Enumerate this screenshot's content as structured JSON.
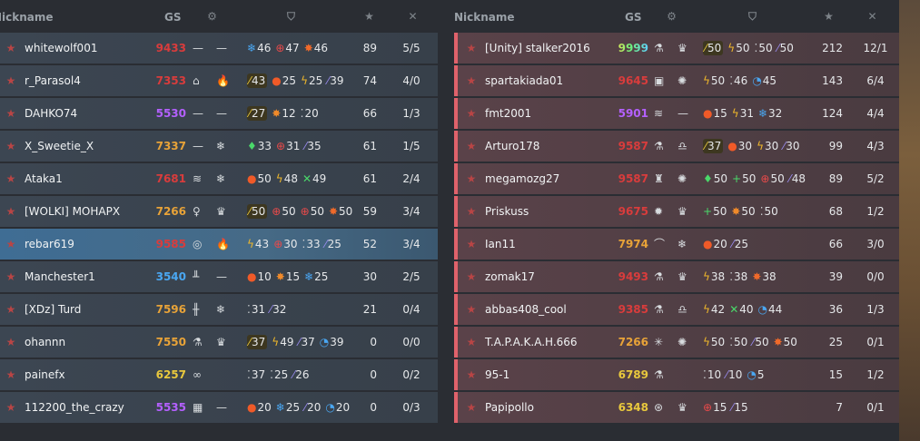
{
  "headers": {
    "nickname": "Nickname",
    "gs": "GS"
  },
  "header_icons": [
    "gear-icon",
    "shield-icon",
    "star-icon",
    "crossed-swords-icon"
  ],
  "colors": {
    "red": "#d93c3c",
    "orange": "#e8a338",
    "purple": "#b460ff",
    "blue": "#4aa7f2",
    "yellow": "#e8c83d",
    "team_accent": "#e0626b"
  },
  "teams": [
    {
      "players": [
        {
          "nick": "whitewolf001",
          "gs": "9433",
          "gs_color": "#d93c3c",
          "rank_icon": "star-rank-icon",
          "eq1": "—",
          "eq2": "—",
          "stats": [
            {
              "icon": "snowflake-icon",
              "g": "❄",
              "c": "#4aa7f2",
              "v": "46"
            },
            {
              "icon": "crosshair-icon",
              "g": "⊕",
              "c": "#e94a4a",
              "v": "47"
            },
            {
              "icon": "burst-icon",
              "g": "✸",
              "c": "#f06a2a",
              "v": "46"
            }
          ],
          "score": "89",
          "kd": "5/5"
        },
        {
          "nick": "r_Parasol4",
          "gs": "7353",
          "gs_color": "#d93c3c",
          "rank_icon": "star-rank-icon",
          "eq1": "⌂",
          "eq2": "🔥",
          "stats": [
            {
              "icon": "bullet-icon",
              "g": "⁄",
              "c": "#e8c83d",
              "v": "43",
              "hl": true
            },
            {
              "icon": "flame-icon",
              "g": "●",
              "c": "#f05a28",
              "v": "25"
            },
            {
              "icon": "lightning-icon",
              "g": "ϟ",
              "c": "#f0b82a",
              "v": "25"
            },
            {
              "icon": "syringe-icon",
              "g": "⁄",
              "c": "#9a8cf0",
              "v": "39"
            }
          ],
          "score": "74",
          "kd": "4/0"
        },
        {
          "nick": "DAHKO74",
          "gs": "5530",
          "gs_color": "#b460ff",
          "rank_icon": "chevron-rank-icon",
          "eq1": "—",
          "eq2": "—",
          "stats": [
            {
              "icon": "bullet-icon",
              "g": "⁄",
              "c": "#e8c83d",
              "v": "27",
              "hl": true
            },
            {
              "icon": "sun-icon",
              "g": "✸",
              "c": "#f08a2a",
              "v": "12"
            },
            {
              "icon": "dots-icon",
              "g": "⁚",
              "c": "#c9cdd0",
              "v": "20"
            }
          ],
          "score": "66",
          "kd": "1/3"
        },
        {
          "nick": "X_Sweetie_X",
          "gs": "7337",
          "gs_color": "#e8a338",
          "rank_icon": "triangle-rank-icon",
          "eq1": "—",
          "eq2": "❄",
          "stats": [
            {
              "icon": "gem-icon",
              "g": "♦",
              "c": "#4ad86a",
              "v": "33"
            },
            {
              "icon": "crosshair-icon",
              "g": "⊕",
              "c": "#e94a4a",
              "v": "31"
            },
            {
              "icon": "syringe-icon",
              "g": "⁄",
              "c": "#9a8cf0",
              "v": "35"
            }
          ],
          "score": "61",
          "kd": "1/5"
        },
        {
          "nick": "Ataka1",
          "gs": "7681",
          "gs_color": "#d93c3c",
          "rank_icon": "star-rank-icon",
          "eq1": "≋",
          "eq2": "❄",
          "stats": [
            {
              "icon": "flame-icon",
              "g": "●",
              "c": "#f05a28",
              "v": "50"
            },
            {
              "icon": "lightning-icon",
              "g": "ϟ",
              "c": "#f0b82a",
              "v": "48"
            },
            {
              "icon": "swords-icon",
              "g": "✕",
              "c": "#4ad86a",
              "v": "49"
            }
          ],
          "score": "61",
          "kd": "2/4"
        },
        {
          "nick": "[WOLKI] MOHAPX",
          "gs": "7266",
          "gs_color": "#e8a338",
          "rank_icon": "star-rank-icon",
          "eq1": "♀",
          "eq2": "♛",
          "stats": [
            {
              "icon": "bullet-icon",
              "g": "⁄",
              "c": "#e8c83d",
              "v": "50",
              "hl": true
            },
            {
              "icon": "crosshair-icon",
              "g": "⊕",
              "c": "#e94a4a",
              "v": "50"
            },
            {
              "icon": "crosshair-icon",
              "g": "⊕",
              "c": "#e94a4a",
              "v": "50"
            },
            {
              "icon": "burst-icon",
              "g": "✸",
              "c": "#f06a2a",
              "v": "50"
            }
          ],
          "score": "59",
          "kd": "3/4"
        },
        {
          "nick": "rebar619",
          "gs": "9585",
          "gs_color": "#d93c3c",
          "rank_icon": "star-rank-icon",
          "me": true,
          "eq1": "◎",
          "eq2": "🔥",
          "stats": [
            {
              "icon": "lightning-icon",
              "g": "ϟ",
              "c": "#f0b82a",
              "v": "43"
            },
            {
              "icon": "crosshair-icon",
              "g": "⊕",
              "c": "#e94a4a",
              "v": "30"
            },
            {
              "icon": "dots-icon",
              "g": "⁚",
              "c": "#c9cdd0",
              "v": "33"
            },
            {
              "icon": "syringe-icon",
              "g": "⁄",
              "c": "#9a8cf0",
              "v": "25"
            }
          ],
          "score": "52",
          "kd": "3/4"
        },
        {
          "nick": "Manchester1",
          "gs": "3540",
          "gs_color": "#4aa7f2",
          "rank_icon": "squares-rank-icon",
          "eq1": "╨",
          "eq2": "—",
          "stats": [
            {
              "icon": "flame-icon",
              "g": "●",
              "c": "#f05a28",
              "v": "10"
            },
            {
              "icon": "sun-icon",
              "g": "✸",
              "c": "#f08a2a",
              "v": "15"
            },
            {
              "icon": "snowflake-icon",
              "g": "❄",
              "c": "#4aa7f2",
              "v": "25"
            }
          ],
          "score": "30",
          "kd": "2/5"
        },
        {
          "nick": "[XDz] Turd",
          "gs": "7596",
          "gs_color": "#e8a338",
          "rank_icon": "pawn-rank-icon",
          "eq1": "╫",
          "eq2": "❄",
          "stats": [
            {
              "icon": "dots-icon",
              "g": "⁚",
              "c": "#c9cdd0",
              "v": "31"
            },
            {
              "icon": "syringe-icon",
              "g": "⁄",
              "c": "#9a8cf0",
              "v": "32"
            }
          ],
          "score": "21",
          "kd": "0/4"
        },
        {
          "nick": "ohannn",
          "gs": "7550",
          "gs_color": "#e8a338",
          "rank_icon": "star-rank-icon",
          "eq1": "⚗",
          "eq2": "♛",
          "stats": [
            {
              "icon": "bullet-icon",
              "g": "⁄",
              "c": "#e8c83d",
              "v": "37",
              "hl": true
            },
            {
              "icon": "lightning-icon",
              "g": "ϟ",
              "c": "#f0b82a",
              "v": "49"
            },
            {
              "icon": "syringe-icon",
              "g": "⁄",
              "c": "#9a8cf0",
              "v": "37"
            },
            {
              "icon": "cycle-icon",
              "g": "◔",
              "c": "#4aa7f2",
              "v": "39"
            }
          ],
          "score": "0",
          "kd": "0/0"
        },
        {
          "nick": "painefx",
          "gs": "6257",
          "gs_color": "#e8c83d",
          "rank_icon": "gear-rank-icon",
          "eq1": "∞",
          "eq2": "",
          "stats": [
            {
              "icon": "dots-icon",
              "g": "⁚",
              "c": "#c9cdd0",
              "v": "37"
            },
            {
              "icon": "dots-icon",
              "g": "⁚",
              "c": "#c9cdd0",
              "v": "25"
            },
            {
              "icon": "syringe-icon",
              "g": "⁄",
              "c": "#9a8cf0",
              "v": "26"
            }
          ],
          "score": "0",
          "kd": "0/2"
        },
        {
          "nick": "112200_the_crazy",
          "gs": "5535",
          "gs_color": "#b460ff",
          "rank_icon": "chevron-rank-icon",
          "eq1": "▦",
          "eq2": "—",
          "stats": [
            {
              "icon": "flame-icon",
              "g": "●",
              "c": "#f05a28",
              "v": "20"
            },
            {
              "icon": "snowflake-icon",
              "g": "❄",
              "c": "#4aa7f2",
              "v": "25"
            },
            {
              "icon": "syringe-icon",
              "g": "⁄",
              "c": "#9a8cf0",
              "v": "20"
            },
            {
              "icon": "cycle-icon",
              "g": "◔",
              "c": "#4aa7f2",
              "v": "20"
            }
          ],
          "score": "0",
          "kd": "0/3"
        }
      ]
    },
    {
      "players": [
        {
          "nick": "[Unity] stalker2016",
          "gs": "9999",
          "gs_color": "rainbow",
          "rank_icon": "winged-star-rank-icon",
          "eq1": "⚗",
          "eq2": "♛",
          "stats": [
            {
              "icon": "bullet-icon",
              "g": "⁄",
              "c": "#e8c83d",
              "v": "50",
              "hl": true
            },
            {
              "icon": "lightning-icon",
              "g": "ϟ",
              "c": "#f0b82a",
              "v": "50"
            },
            {
              "icon": "dots-icon",
              "g": "⁚",
              "c": "#c9cdd0",
              "v": "50"
            },
            {
              "icon": "syringe-icon",
              "g": "⁄",
              "c": "#9a8cf0",
              "v": "50"
            }
          ],
          "score": "212",
          "kd": "12/1"
        },
        {
          "nick": "spartakiada01",
          "gs": "9645",
          "gs_color": "#d93c3c",
          "rank_icon": "star-rank-icon",
          "eq1": "▣",
          "eq2": "✺",
          "stats": [
            {
              "icon": "lightning-icon",
              "g": "ϟ",
              "c": "#f0b82a",
              "v": "50"
            },
            {
              "icon": "dots-icon",
              "g": "⁚",
              "c": "#c9cdd0",
              "v": "46"
            },
            {
              "icon": "cycle-icon",
              "g": "◔",
              "c": "#4aa7f2",
              "v": "45"
            }
          ],
          "score": "143",
          "kd": "6/4"
        },
        {
          "nick": "fmt2001",
          "gs": "5901",
          "gs_color": "#b460ff",
          "rank_icon": "triangle-rank-icon",
          "eq1": "≋",
          "eq2": "—",
          "stats": [
            {
              "icon": "flame-icon",
              "g": "●",
              "c": "#f05a28",
              "v": "15"
            },
            {
              "icon": "lightning-icon",
              "g": "ϟ",
              "c": "#f0b82a",
              "v": "31"
            },
            {
              "icon": "snowflake-icon",
              "g": "❄",
              "c": "#4aa7f2",
              "v": "32"
            }
          ],
          "score": "124",
          "kd": "4/4"
        },
        {
          "nick": "Arturo178",
          "gs": "9587",
          "gs_color": "#d93c3c",
          "rank_icon": "star-rank-icon",
          "eq1": "⚗",
          "eq2": "♎",
          "stats": [
            {
              "icon": "bullet-icon",
              "g": "⁄",
              "c": "#e8c83d",
              "v": "37",
              "hl": true
            },
            {
              "icon": "flame-icon",
              "g": "●",
              "c": "#f05a28",
              "v": "30"
            },
            {
              "icon": "lightning-icon",
              "g": "ϟ",
              "c": "#f0b82a",
              "v": "30"
            },
            {
              "icon": "syringe-icon",
              "g": "⁄",
              "c": "#9a8cf0",
              "v": "30"
            }
          ],
          "score": "99",
          "kd": "4/3"
        },
        {
          "nick": "megamozg27",
          "gs": "9587",
          "gs_color": "#d93c3c",
          "rank_icon": "star-rank-icon",
          "eq1": "♜",
          "eq2": "✺",
          "stats": [
            {
              "icon": "gem-icon",
              "g": "♦",
              "c": "#4ad86a",
              "v": "50"
            },
            {
              "icon": "plus-icon",
              "g": "+",
              "c": "#4ad86a",
              "v": "50"
            },
            {
              "icon": "crosshair-icon",
              "g": "⊕",
              "c": "#e94a4a",
              "v": "50"
            },
            {
              "icon": "syringe-icon",
              "g": "⁄",
              "c": "#9a8cf0",
              "v": "48"
            }
          ],
          "score": "89",
          "kd": "5/2"
        },
        {
          "nick": "Priskuss",
          "gs": "9675",
          "gs_color": "#d93c3c",
          "rank_icon": "star-rank-icon",
          "eq1": "✹",
          "eq2": "♛",
          "stats": [
            {
              "icon": "plus-icon",
              "g": "+",
              "c": "#4ad86a",
              "v": "50"
            },
            {
              "icon": "sun-icon",
              "g": "✸",
              "c": "#f08a2a",
              "v": "50"
            },
            {
              "icon": "dots-icon",
              "g": "⁚",
              "c": "#c9cdd0",
              "v": "50"
            }
          ],
          "score": "68",
          "kd": "1/2"
        },
        {
          "nick": "Ian11",
          "gs": "7974",
          "gs_color": "#e8a338",
          "rank_icon": "diamond-rank-icon",
          "eq1": "⌒",
          "eq2": "❄",
          "stats": [
            {
              "icon": "flame-icon",
              "g": "●",
              "c": "#f05a28",
              "v": "20"
            },
            {
              "icon": "syringe-icon",
              "g": "⁄",
              "c": "#9a8cf0",
              "v": "25"
            }
          ],
          "score": "66",
          "kd": "3/0"
        },
        {
          "nick": "zomak17",
          "gs": "9493",
          "gs_color": "#d93c3c",
          "rank_icon": "star-rank-icon",
          "eq1": "⚗",
          "eq2": "♛",
          "stats": [
            {
              "icon": "lightning-icon",
              "g": "ϟ",
              "c": "#f0b82a",
              "v": "38"
            },
            {
              "icon": "dots-icon",
              "g": "⁚",
              "c": "#c9cdd0",
              "v": "38"
            },
            {
              "icon": "burst-icon",
              "g": "✸",
              "c": "#f06a2a",
              "v": "38"
            }
          ],
          "score": "39",
          "kd": "0/0"
        },
        {
          "nick": "abbas408_cool",
          "gs": "9385",
          "gs_color": "#d93c3c",
          "rank_icon": "star-rank-icon",
          "eq1": "⚗",
          "eq2": "♎",
          "stats": [
            {
              "icon": "lightning-icon",
              "g": "ϟ",
              "c": "#f0b82a",
              "v": "42"
            },
            {
              "icon": "swords-icon",
              "g": "✕",
              "c": "#4ad86a",
              "v": "40"
            },
            {
              "icon": "cycle-icon",
              "g": "◔",
              "c": "#4aa7f2",
              "v": "44"
            }
          ],
          "score": "36",
          "kd": "1/3"
        },
        {
          "nick": "T.A.P.A.K.A.H.666",
          "gs": "7266",
          "gs_color": "#e8a338",
          "rank_icon": "star-rank-icon",
          "eq1": "✳",
          "eq2": "✺",
          "stats": [
            {
              "icon": "lightning-icon",
              "g": "ϟ",
              "c": "#f0b82a",
              "v": "50"
            },
            {
              "icon": "dots-icon",
              "g": "⁚",
              "c": "#c9cdd0",
              "v": "50"
            },
            {
              "icon": "syringe-icon",
              "g": "⁄",
              "c": "#9a8cf0",
              "v": "50"
            },
            {
              "icon": "burst-icon",
              "g": "✸",
              "c": "#f06a2a",
              "v": "50"
            }
          ],
          "score": "25",
          "kd": "0/1"
        },
        {
          "nick": "95-1",
          "gs": "6789",
          "gs_color": "#e8c83d",
          "rank_icon": "star-rank-icon",
          "eq1": "⚗",
          "eq2": "",
          "stats": [
            {
              "icon": "dots-icon",
              "g": "⁚",
              "c": "#c9cdd0",
              "v": "10"
            },
            {
              "icon": "syringe-icon",
              "g": "⁄",
              "c": "#9a8cf0",
              "v": "10"
            },
            {
              "icon": "cycle-icon",
              "g": "◔",
              "c": "#4aa7f2",
              "v": "5"
            }
          ],
          "score": "15",
          "kd": "1/2"
        },
        {
          "nick": "Papipollo",
          "gs": "6348",
          "gs_color": "#e8c83d",
          "rank_icon": "diamond-rank-icon",
          "eq1": "⊛",
          "eq2": "♛",
          "stats": [
            {
              "icon": "crosshair-icon",
              "g": "⊕",
              "c": "#e94a4a",
              "v": "15"
            },
            {
              "icon": "syringe-icon",
              "g": "⁄",
              "c": "#9a8cf0",
              "v": "15"
            }
          ],
          "score": "7",
          "kd": "0/1"
        }
      ]
    }
  ]
}
